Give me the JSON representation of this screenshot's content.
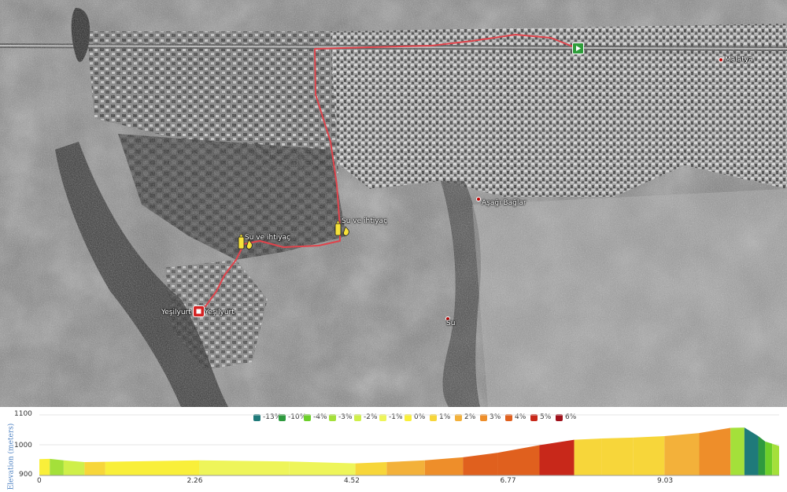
{
  "map": {
    "places": [
      {
        "id": "malatya",
        "label": "Malatya"
      },
      {
        "id": "asagi-baglar",
        "label": "Aşağı Bağlar"
      },
      {
        "id": "su-1",
        "label": "Su"
      },
      {
        "id": "yesilyurt",
        "label": "Yeşilyurt"
      },
      {
        "id": "yesilyurt-2",
        "label": "Yeşilyurt"
      }
    ],
    "waypoints": [
      {
        "id": "water-1",
        "label": "Su ve ihtiyaç",
        "icon": "water-bottle-icon"
      },
      {
        "id": "water-2",
        "label": "Su ve ihtiyaç",
        "icon": "water-bottle-icon"
      }
    ],
    "route_color": "#e0444c",
    "start_color": "#2e9d3a",
    "end_color": "#d42222"
  },
  "chart_data": {
    "type": "area",
    "title": "",
    "xlabel": "",
    "ylabel": "Elevation (meters)",
    "ylim": [
      900,
      1100
    ],
    "xlim": [
      0,
      10.45
    ],
    "y_ticks": [
      "1100",
      "1000",
      "900"
    ],
    "x_ticks": [
      "0",
      "2.26",
      "4.52",
      "6.77",
      "9.03"
    ],
    "legend": [
      {
        "label": "-13%",
        "color": "#1f7a7a"
      },
      {
        "label": "-10%",
        "color": "#2e9a3e"
      },
      {
        "label": "-4%",
        "color": "#6ccf2a"
      },
      {
        "label": "-3%",
        "color": "#a4e03a"
      },
      {
        "label": "-2%",
        "color": "#cfef4a"
      },
      {
        "label": "-1%",
        "color": "#eef55a"
      },
      {
        "label": "0%",
        "color": "#f9ef3a"
      },
      {
        "label": "1%",
        "color": "#f7d63a"
      },
      {
        "label": "2%",
        "color": "#f3b13a"
      },
      {
        "label": "3%",
        "color": "#ee8e2a"
      },
      {
        "label": "4%",
        "color": "#e0601e"
      },
      {
        "label": "5%",
        "color": "#c8281a"
      },
      {
        "label": "6%",
        "color": "#a0101a"
      }
    ],
    "segments": [
      {
        "x0": 0.0,
        "x1": 0.15,
        "e0": 954,
        "e1": 955,
        "grade": "0%"
      },
      {
        "x0": 0.15,
        "x1": 0.35,
        "e0": 955,
        "e1": 950,
        "grade": "-3%"
      },
      {
        "x0": 0.35,
        "x1": 0.65,
        "e0": 950,
        "e1": 944,
        "grade": "-2%"
      },
      {
        "x0": 0.65,
        "x1": 0.95,
        "e0": 944,
        "e1": 945,
        "grade": "1%"
      },
      {
        "x0": 0.95,
        "x1": 2.3,
        "e0": 945,
        "e1": 950,
        "grade": "0%"
      },
      {
        "x0": 2.3,
        "x1": 3.6,
        "e0": 950,
        "e1": 946,
        "grade": "-1%"
      },
      {
        "x0": 3.6,
        "x1": 4.55,
        "e0": 946,
        "e1": 940,
        "grade": "-1%"
      },
      {
        "x0": 4.55,
        "x1": 5.0,
        "e0": 940,
        "e1": 944,
        "grade": "1%"
      },
      {
        "x0": 5.0,
        "x1": 5.55,
        "e0": 944,
        "e1": 950,
        "grade": "2%"
      },
      {
        "x0": 5.55,
        "x1": 6.1,
        "e0": 950,
        "e1": 960,
        "grade": "3%"
      },
      {
        "x0": 6.1,
        "x1": 6.6,
        "e0": 960,
        "e1": 975,
        "grade": "4%"
      },
      {
        "x0": 6.6,
        "x1": 7.2,
        "e0": 975,
        "e1": 1000,
        "grade": "4%"
      },
      {
        "x0": 7.2,
        "x1": 7.7,
        "e0": 1000,
        "e1": 1018,
        "grade": "5%"
      },
      {
        "x0": 7.7,
        "x1": 8.1,
        "e0": 1018,
        "e1": 1022,
        "grade": "1%"
      },
      {
        "x0": 8.1,
        "x1": 8.55,
        "e0": 1022,
        "e1": 1025,
        "grade": "1%"
      },
      {
        "x0": 8.55,
        "x1": 9.0,
        "e0": 1025,
        "e1": 1030,
        "grade": "1%"
      },
      {
        "x0": 9.0,
        "x1": 9.5,
        "e0": 1030,
        "e1": 1040,
        "grade": "2%"
      },
      {
        "x0": 9.5,
        "x1": 9.95,
        "e0": 1040,
        "e1": 1057,
        "grade": "3%"
      },
      {
        "x0": 9.95,
        "x1": 10.15,
        "e0": 1057,
        "e1": 1058,
        "grade": "-3%"
      },
      {
        "x0": 10.15,
        "x1": 10.35,
        "e0": 1058,
        "e1": 1030,
        "grade": "-13%"
      },
      {
        "x0": 10.35,
        "x1": 10.45,
        "e0": 1030,
        "e1": 1012,
        "grade": "-10%"
      },
      {
        "x0": 10.45,
        "x1": 10.55,
        "e0": 1012,
        "e1": 1005,
        "grade": "-4%"
      },
      {
        "x0": 10.55,
        "x1": 10.65,
        "e0": 1005,
        "e1": 997,
        "grade": "-3%"
      }
    ]
  }
}
